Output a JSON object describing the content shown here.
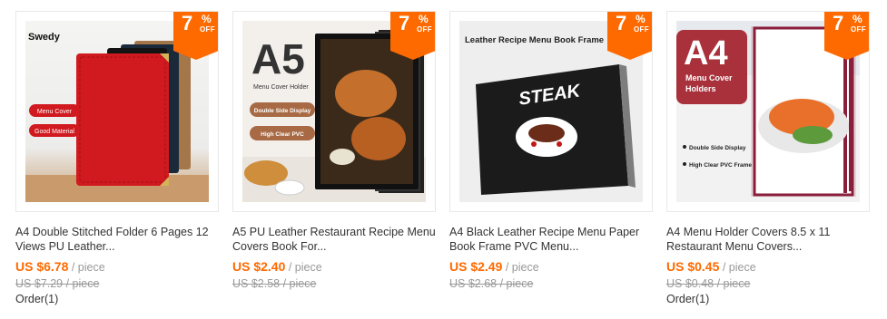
{
  "colors": {
    "accent": "#ff6a00",
    "muted": "#999999",
    "text": "#333333"
  },
  "products": [
    {
      "badge": {
        "number": "7",
        "percent": "%",
        "off": "OFF"
      },
      "image_text": [
        "Swedy",
        "Menu Cover",
        "Good Material"
      ],
      "title_line1": "A4 Double Stitched Folder 6 Pages 12",
      "title_line2": "Views PU Leather...",
      "price": "US $6.78",
      "unit": " / piece",
      "old_price": "US $7.29 / piece",
      "orders": "Order(1)"
    },
    {
      "badge": {
        "number": "7",
        "percent": "%",
        "off": "OFF"
      },
      "image_text": [
        "A5",
        "Menu Cover Holder",
        "Double Side Display",
        "High Clear PVC"
      ],
      "title_line1": "A5 PU Leather Restaurant Recipe Menu",
      "title_line2": "Covers Book For...",
      "price": "US $2.40",
      "unit": " / piece",
      "old_price": "US $2.58 / piece",
      "orders": ""
    },
    {
      "badge": {
        "number": "7",
        "percent": "%",
        "off": "OFF"
      },
      "image_text": [
        "Leather Recipe Menu Book Frame",
        "STEAK"
      ],
      "title_line1": "A4 Black Leather Recipe Menu Paper",
      "title_line2": "Book Frame PVC Menu...",
      "price": "US $2.49",
      "unit": " / piece",
      "old_price": "US $2.68 / piece",
      "orders": ""
    },
    {
      "badge": {
        "number": "7",
        "percent": "%",
        "off": "OFF"
      },
      "image_text": [
        "A4",
        "Menu Cover",
        "Holders",
        "Double Side Display",
        "High Clear PVC Frame"
      ],
      "title_line1": "A4 Menu Holder Covers 8.5 x 11",
      "title_line2": "Restaurant Menu Covers...",
      "price": "US $0.45",
      "unit": " / piece",
      "old_price": "US $0.48 / piece",
      "orders": "Order(1)"
    }
  ]
}
